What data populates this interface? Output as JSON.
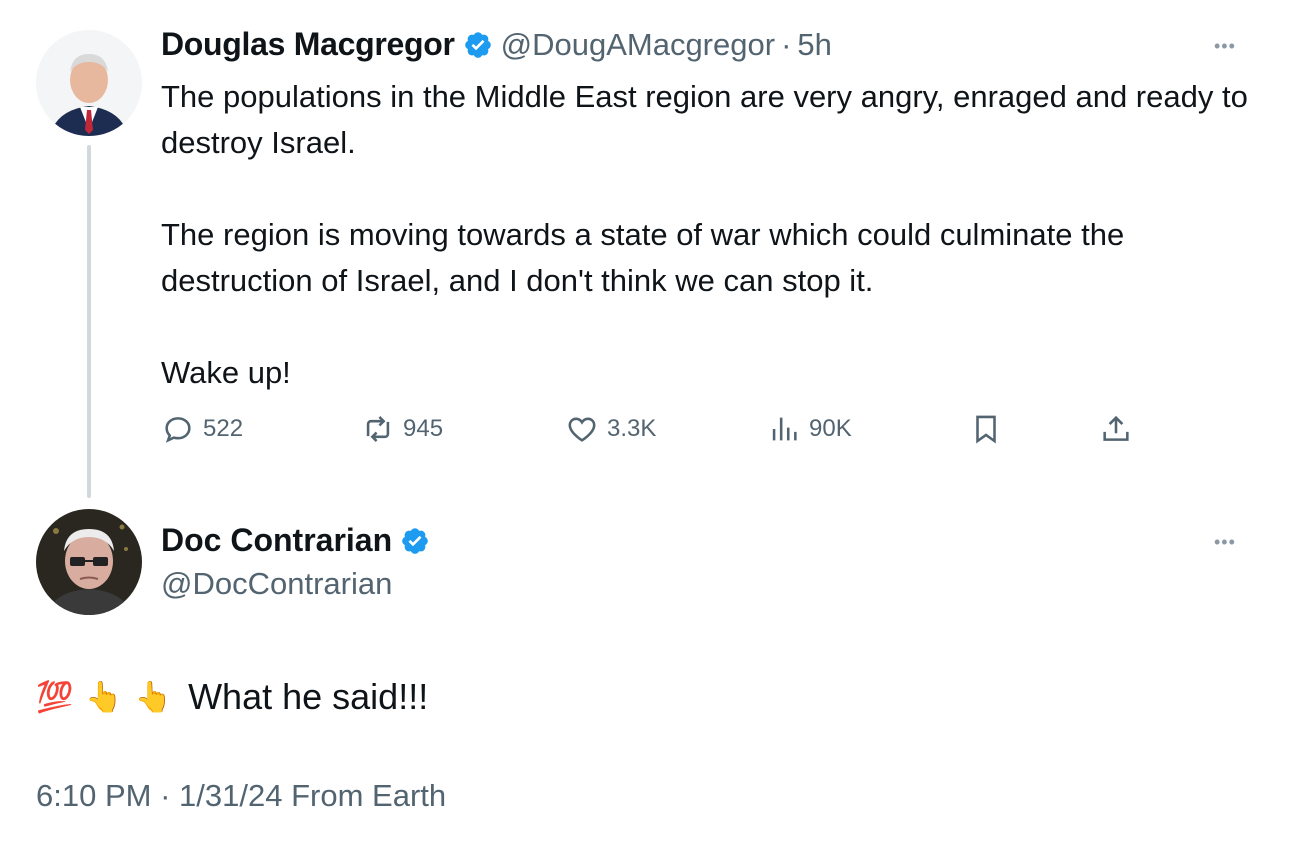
{
  "parent": {
    "name": "Douglas Macgregor",
    "handle": "@DougAMacgregor",
    "separator": "·",
    "time": "5h",
    "paragraphs": [
      "The populations in the Middle East region are very angry, enraged and ready to destroy Israel.",
      "The region is moving towards a state of war which could culminate the destruction of Israel, and I don't think we can stop it.",
      "Wake up!"
    ],
    "stats": {
      "replies": "522",
      "reposts": "945",
      "likes": "3.3K",
      "views": "90K"
    },
    "more": "•••"
  },
  "reply": {
    "name": "Doc Contrarian",
    "handle": "@DocContrarian",
    "text": "What he said!!!",
    "emojis": [
      "💯",
      "👆",
      "👆"
    ],
    "timestamp": "6:10 PM",
    "separator": "·",
    "date": "1/31/24",
    "source": "From Earth",
    "more": "•••"
  },
  "colors": {
    "verified": "#1d9bf0",
    "muted": "#536471",
    "thread_line": "#cfd9de",
    "text": "#0f1419"
  },
  "icons": {
    "reply": "speech-bubble-icon",
    "repost": "repost-arrows-icon",
    "like": "heart-icon",
    "views": "bar-chart-icon",
    "bookmark": "bookmark-icon",
    "share": "upload-share-icon"
  }
}
